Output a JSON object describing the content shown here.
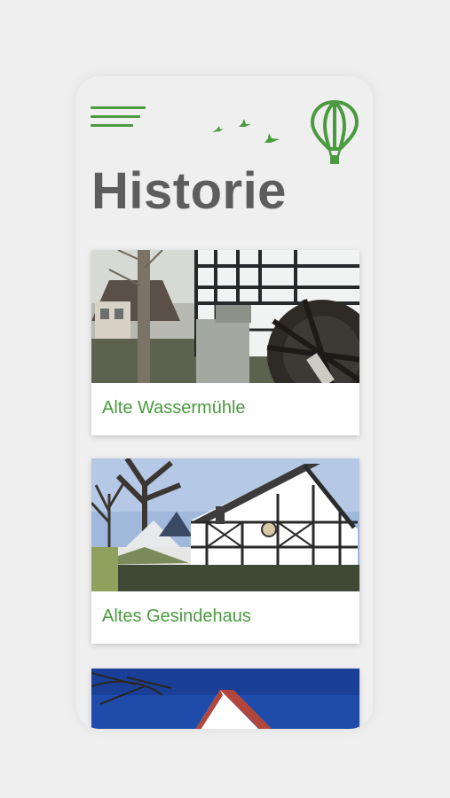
{
  "page": {
    "title": "Historie"
  },
  "header": {
    "menu_icon": "hamburger-menu-icon",
    "birds_icon": "flying-birds-icon",
    "logo_icon": "hot-air-balloon-icon"
  },
  "cards": [
    {
      "label": "Alte Wassermühle",
      "image": "half-timbered-mill-with-water-wheel-photo"
    },
    {
      "label": "Altes Gesindehaus",
      "image": "half-timbered-house-with-trees-photo"
    },
    {
      "label": "",
      "image": "white-house-red-roof-blue-sky-photo"
    }
  ],
  "colors": {
    "accent": "#4a9a3f",
    "title": "#5d5d5d",
    "background": "#efefef",
    "card": "#ffffff"
  }
}
